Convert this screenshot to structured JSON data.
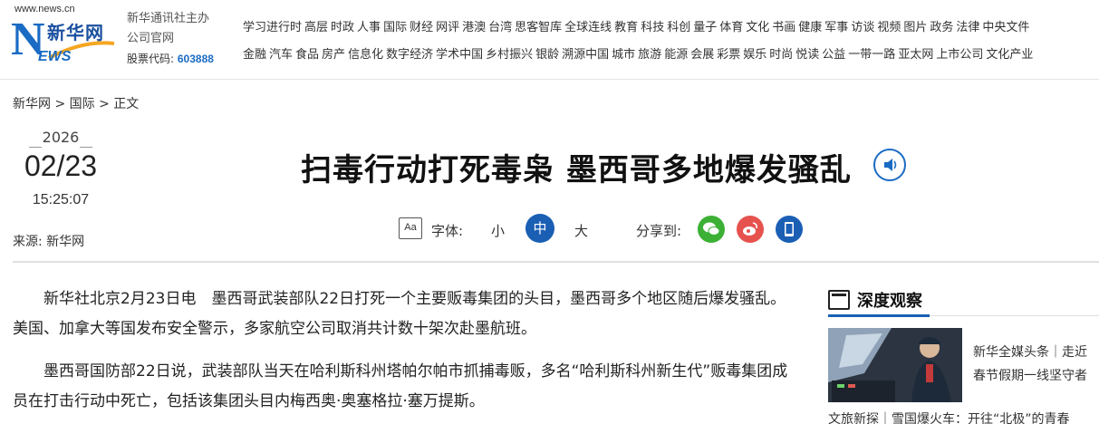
{
  "header": {
    "logo_url": "www.news.cn",
    "logo_cn": "新华网",
    "logo_letter": "N",
    "logo_ews": "EWS",
    "org_line1": "新华通讯社主办",
    "org_line2": "公司官网",
    "stock_label": "股票代码:",
    "stock_code": "603888",
    "nav_row1": [
      "学习进行时",
      "高层",
      "时政",
      "人事",
      "国际",
      "财经",
      "网评",
      "港澳",
      "台湾",
      "思客智库",
      "全球连线",
      "教育",
      "科技",
      "科创",
      "量子",
      "体育",
      "文化",
      "书画",
      "健康",
      "军事",
      "访谈",
      "视频",
      "图片",
      "政务",
      "法律",
      "中央文件"
    ],
    "nav_row2": [
      "金融",
      "汽车",
      "食品",
      "房产",
      "信息化",
      "数字经济",
      "学术中国",
      "乡村振兴",
      "银龄",
      "溯源中国",
      "城市",
      "旅游",
      "能源",
      "会展",
      "彩票",
      "娱乐",
      "时尚",
      "悦读",
      "公益",
      "一带一路",
      "亚太网",
      "上市公司",
      "文化产业"
    ]
  },
  "breadcrumb": {
    "home": "新华网",
    "sep1": " > ",
    "section": "国际",
    "sep2": " > ",
    "current": "正文"
  },
  "date": {
    "year": "2026",
    "month_day": "02/23",
    "time": "15:25:07",
    "source_label": "来源:",
    "source": "新华网"
  },
  "article": {
    "title": "扫毒行动打死毒枭 墨西哥多地爆发骚乱",
    "paragraphs": [
      "新华社北京2月23日电　墨西哥武装部队22日打死一个主要贩毒集团的头目，墨西哥多个地区随后爆发骚乱。美国、加拿大等国发布安全警示，多家航空公司取消共计数十架次赴墨航班。",
      "墨西哥国防部22日说，武装部队当天在哈利斯科州塔帕尔帕市抓捕毒贩，多名“哈利斯科州新生代”贩毒集团成员在打击行动中死亡，包括该集团头目内梅西奥·奥塞格拉·塞万提斯。"
    ]
  },
  "toolbar": {
    "font_icon_text": "Aa",
    "font_label": "字体:",
    "size_small": "小",
    "size_medium": "中",
    "size_large": "大",
    "share_label": "分享到:",
    "colors": {
      "accent": "#1a5fb4",
      "wechat": "#3cb035",
      "weibo": "#e6524e",
      "mobile": "#1a5fb4"
    }
  },
  "sidebar": {
    "title": "深度观察",
    "caption": "新华全媒头条｜走近春节假期一线坚守者",
    "bottom_item": "文旅新探｜雪国爆火车：开往“北极”的青春"
  }
}
